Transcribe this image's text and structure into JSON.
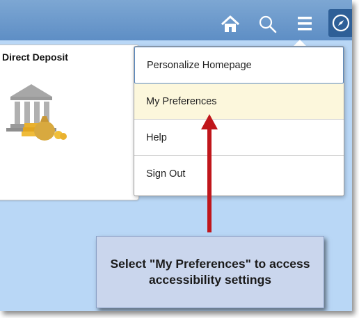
{
  "header": {
    "icons": [
      "home-icon",
      "search-icon",
      "menu-icon",
      "navbar-compass-icon"
    ]
  },
  "tile": {
    "title": "Direct Deposit",
    "icon": "bank-with-money-bag-icon"
  },
  "dropdown": {
    "items": [
      {
        "label": "Personalize Homepage"
      },
      {
        "label": "My Preferences"
      },
      {
        "label": "Help"
      },
      {
        "label": "Sign Out"
      }
    ]
  },
  "annotation": {
    "text": "Select \"My Preferences\" to access accessibility settings",
    "arrow_color": "#c0161b"
  },
  "colors": {
    "header": "#6e9bcc",
    "page_background": "#b9d7f6",
    "highlight_item": "#fcf7dc",
    "navbar_button": "#2e5f97",
    "callout_background": "#cad6ed"
  }
}
